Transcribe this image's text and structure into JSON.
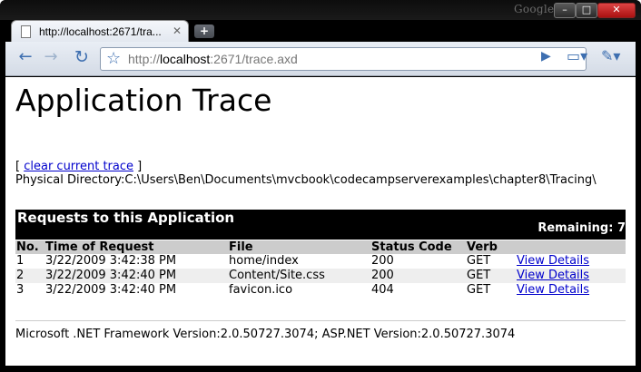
{
  "window": {
    "brand": "Google",
    "minimize_glyph": "–",
    "maximize_glyph": "□",
    "close_glyph": "✕"
  },
  "tab": {
    "title": "http://localhost:2671/tra...",
    "close_glyph": "✕",
    "new_tab_glyph": "+"
  },
  "toolbar": {
    "back_glyph": "←",
    "forward_glyph": "→",
    "reload_glyph": "↻",
    "star_glyph": "☆",
    "url_prefix": "http://",
    "url_host": "localhost",
    "url_rest": ":2671/trace.axd",
    "go_glyph": "▶",
    "page_menu_glyph": "▭▾",
    "tools_menu_glyph": "✎▾"
  },
  "page": {
    "title": "Application Trace",
    "clear_open": "[ ",
    "clear_link": "clear current trace",
    "clear_close": " ]",
    "physical_directory": "Physical Directory:C:\\Users\\Ben\\Documents\\mvcbook\\codecampserverexamples\\chapter8\\Tracing\\",
    "requests_heading": "Requests to this Application",
    "remaining": "Remaining: 7",
    "columns": [
      "No.",
      "Time of Request",
      "File",
      "Status Code",
      "Verb",
      ""
    ],
    "rows": [
      {
        "no": "1",
        "time": "3/22/2009 3:42:38 PM",
        "file": "home/index",
        "status": "200",
        "verb": "GET",
        "link": "View Details"
      },
      {
        "no": "2",
        "time": "3/22/2009 3:42:40 PM",
        "file": "Content/Site.css",
        "status": "200",
        "verb": "GET",
        "link": "View Details"
      },
      {
        "no": "3",
        "time": "3/22/2009 3:42:40 PM",
        "file": "favicon.ico",
        "status": "404",
        "verb": "GET",
        "link": "View Details"
      }
    ],
    "footer": "Microsoft .NET Framework Version:2.0.50727.3074; ASP.NET Version:2.0.50727.3074"
  }
}
